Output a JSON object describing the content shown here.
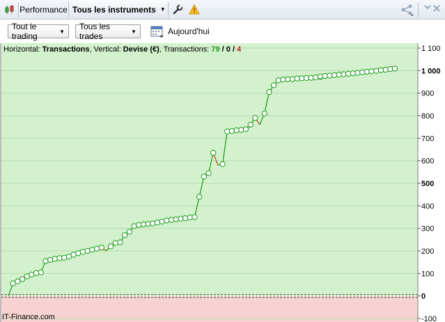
{
  "toolbar": {
    "tab_performance": "Performance",
    "tab_instruments": "Tous les instruments",
    "icons": [
      "candlestick-icon",
      "wrench-icon",
      "warning-icon",
      "share-icon"
    ]
  },
  "filters": {
    "trading": "Tout le trading",
    "trades": "Tous les trades",
    "date_label": "Aujourd'hui"
  },
  "info": {
    "horizontal_prefix": "Horizontal: ",
    "horizontal_value": "Transactions",
    "vertical_prefix": ", Vertical: ",
    "vertical_value": "Devise (€)",
    "tx_prefix": ", Transactions: ",
    "tx_win": "79",
    "tx_sep1": " / ",
    "tx_even": "0",
    "tx_sep2": " / ",
    "tx_loss": "4"
  },
  "footer": "IT-Finance.com",
  "colors": {
    "profit_zone": "#d2f1cc",
    "loss_zone": "#f6d3d2",
    "line_up": "#1a9a1a",
    "line_down": "#c83c2c",
    "win_count": "#1f9a1f",
    "loss_count": "#c21f1f"
  },
  "chart_data": {
    "type": "line",
    "xlabel": "Transactions",
    "ylabel": "Devise (€)",
    "ylim": [
      -100,
      1100
    ],
    "y_ticks": [
      {
        "v": 1100,
        "label": "1 100",
        "bold": false
      },
      {
        "v": 1000,
        "label": "1 000",
        "bold": true
      },
      {
        "v": 900,
        "label": "900",
        "bold": false
      },
      {
        "v": 800,
        "label": "800",
        "bold": false
      },
      {
        "v": 700,
        "label": "700",
        "bold": false
      },
      {
        "v": 600,
        "label": "600",
        "bold": false
      },
      {
        "v": 500,
        "label": "500",
        "bold": true
      },
      {
        "v": 400,
        "label": "400",
        "bold": false
      },
      {
        "v": 300,
        "label": "300",
        "bold": false
      },
      {
        "v": 200,
        "label": "200",
        "bold": false
      },
      {
        "v": 100,
        "label": "100",
        "bold": false
      },
      {
        "v": 0,
        "label": "0",
        "bold": true
      },
      {
        "v": -100,
        "label": "-100",
        "bold": false
      }
    ],
    "x": [
      0,
      1,
      2,
      3,
      4,
      5,
      6,
      7,
      8,
      9,
      10,
      11,
      12,
      13,
      14,
      15,
      16,
      17,
      18,
      19,
      20,
      21,
      22,
      23,
      24,
      25,
      26,
      27,
      28,
      29,
      30,
      31,
      32,
      33,
      34,
      35,
      36,
      37,
      38,
      39,
      40,
      41,
      42,
      43,
      44,
      45,
      46,
      47,
      48,
      49,
      50,
      51,
      52,
      53,
      54,
      55,
      56,
      57,
      58,
      59,
      60,
      61,
      62,
      63,
      64,
      65,
      66,
      67,
      67,
      68,
      69,
      70,
      71,
      72,
      73,
      74,
      75,
      76,
      77,
      78,
      79,
      80,
      81,
      82,
      83
    ],
    "series": [
      {
        "values": [
          0,
          56,
          65,
          75,
          87,
          95,
          102,
          105,
          155,
          160,
          165,
          168,
          170,
          175,
          183,
          190,
          196,
          200,
          205,
          210,
          215,
          200,
          220,
          235,
          238,
          270,
          285,
          310,
          315,
          318,
          320,
          322,
          326,
          330,
          335,
          338,
          340,
          343,
          345,
          348,
          350,
          440,
          530,
          545,
          635,
          580,
          585,
          730,
          732,
          735,
          737,
          740,
          760,
          790,
          760,
          810,
          905,
          935,
          957,
          960,
          962,
          963,
          965,
          966,
          967,
          968,
          970,
          972,
          974,
          976,
          978,
          980,
          982,
          984,
          986,
          988,
          990,
          993,
          995,
          997,
          999,
          1002,
          1004,
          1007,
          1009
        ]
      }
    ]
  }
}
